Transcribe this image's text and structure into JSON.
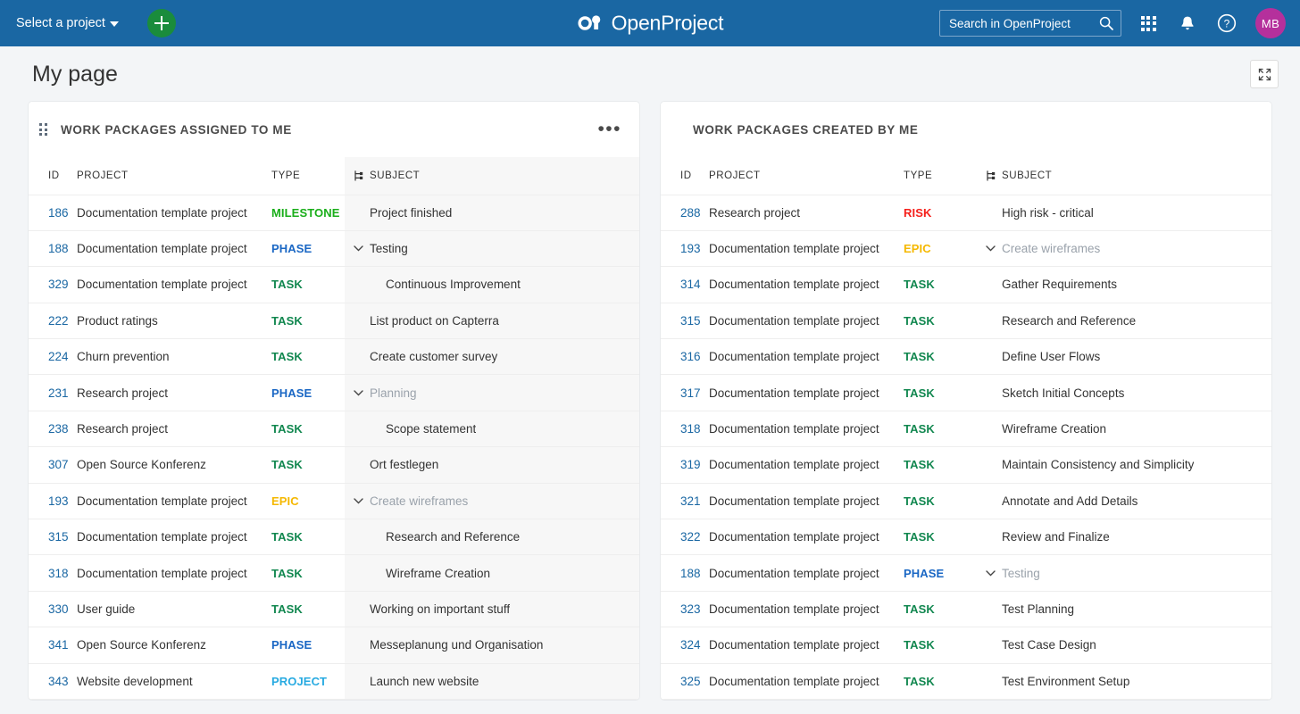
{
  "header": {
    "project_select_label": "Select a project",
    "add_button_label": "+",
    "brand_name": "OpenProject",
    "search_placeholder": "Search in OpenProject",
    "search_value": "",
    "avatar_initials": "MB"
  },
  "toolbar": {
    "page_title": "My page"
  },
  "widgets": [
    {
      "id": "assigned-to-me",
      "title": "WORK PACKAGES ASSIGNED TO ME",
      "menu_label": "•••",
      "columns": [
        "ID",
        "PROJECT",
        "TYPE",
        "SUBJECT"
      ],
      "rows": [
        {
          "id": "186",
          "project": "Documentation template project",
          "type": "MILESTONE",
          "subject": "Project finished",
          "indent": 0,
          "expandable": false,
          "ghost": false
        },
        {
          "id": "188",
          "project": "Documentation template project",
          "type": "PHASE",
          "subject": "Testing",
          "indent": 0,
          "expandable": true,
          "ghost": false
        },
        {
          "id": "329",
          "project": "Documentation template project",
          "type": "TASK",
          "subject": "Continuous Improvement",
          "indent": 1,
          "expandable": false,
          "ghost": false
        },
        {
          "id": "222",
          "project": "Product ratings",
          "type": "TASK",
          "subject": "List product on Capterra",
          "indent": 0,
          "expandable": false,
          "ghost": false
        },
        {
          "id": "224",
          "project": "Churn prevention",
          "type": "TASK",
          "subject": "Create customer survey",
          "indent": 0,
          "expandable": false,
          "ghost": false
        },
        {
          "id": "231",
          "project": "Research project",
          "type": "PHASE",
          "subject": "Planning",
          "indent": 0,
          "expandable": true,
          "ghost": true
        },
        {
          "id": "238",
          "project": "Research project",
          "type": "TASK",
          "subject": "Scope statement",
          "indent": 1,
          "expandable": false,
          "ghost": false
        },
        {
          "id": "307",
          "project": "Open Source Konferenz",
          "type": "TASK",
          "subject": "Ort festlegen",
          "indent": 0,
          "expandable": false,
          "ghost": false
        },
        {
          "id": "193",
          "project": "Documentation template project",
          "type": "EPIC",
          "subject": "Create wireframes",
          "indent": 0,
          "expandable": true,
          "ghost": true
        },
        {
          "id": "315",
          "project": "Documentation template project",
          "type": "TASK",
          "subject": "Research and Reference",
          "indent": 1,
          "expandable": false,
          "ghost": false
        },
        {
          "id": "318",
          "project": "Documentation template project",
          "type": "TASK",
          "subject": "Wireframe Creation",
          "indent": 1,
          "expandable": false,
          "ghost": false
        },
        {
          "id": "330",
          "project": "User guide",
          "type": "TASK",
          "subject": "Working on important stuff",
          "indent": 0,
          "expandable": false,
          "ghost": false
        },
        {
          "id": "341",
          "project": "Open Source Konferenz",
          "type": "PHASE",
          "subject": "Messeplanung und Organisation",
          "indent": 0,
          "expandable": false,
          "ghost": false
        },
        {
          "id": "343",
          "project": "Website development",
          "type": "PROJECT",
          "subject": "Launch new website",
          "indent": 0,
          "expandable": false,
          "ghost": false
        }
      ]
    },
    {
      "id": "created-by-me",
      "title": "WORK PACKAGES CREATED BY ME",
      "menu_label": "",
      "columns": [
        "ID",
        "PROJECT",
        "TYPE",
        "SUBJECT"
      ],
      "rows": [
        {
          "id": "288",
          "project": "Research project",
          "type": "RISK",
          "subject": "High risk - critical",
          "indent": 0,
          "expandable": false,
          "ghost": false
        },
        {
          "id": "193",
          "project": "Documentation template project",
          "type": "EPIC",
          "subject": "Create wireframes",
          "indent": 0,
          "expandable": true,
          "ghost": true
        },
        {
          "id": "314",
          "project": "Documentation template project",
          "type": "TASK",
          "subject": "Gather Requirements",
          "indent": 0,
          "expandable": false,
          "ghost": false
        },
        {
          "id": "315",
          "project": "Documentation template project",
          "type": "TASK",
          "subject": "Research and Reference",
          "indent": 0,
          "expandable": false,
          "ghost": false
        },
        {
          "id": "316",
          "project": "Documentation template project",
          "type": "TASK",
          "subject": "Define User Flows",
          "indent": 0,
          "expandable": false,
          "ghost": false
        },
        {
          "id": "317",
          "project": "Documentation template project",
          "type": "TASK",
          "subject": "Sketch Initial Concepts",
          "indent": 0,
          "expandable": false,
          "ghost": false
        },
        {
          "id": "318",
          "project": "Documentation template project",
          "type": "TASK",
          "subject": "Wireframe Creation",
          "indent": 0,
          "expandable": false,
          "ghost": false
        },
        {
          "id": "319",
          "project": "Documentation template project",
          "type": "TASK",
          "subject": "Maintain Consistency and Simplicity",
          "indent": 0,
          "expandable": false,
          "ghost": false
        },
        {
          "id": "321",
          "project": "Documentation template project",
          "type": "TASK",
          "subject": "Annotate and Add Details",
          "indent": 0,
          "expandable": false,
          "ghost": false
        },
        {
          "id": "322",
          "project": "Documentation template project",
          "type": "TASK",
          "subject": "Review and Finalize",
          "indent": 0,
          "expandable": false,
          "ghost": false
        },
        {
          "id": "188",
          "project": "Documentation template project",
          "type": "PHASE",
          "subject": "Testing",
          "indent": 0,
          "expandable": true,
          "ghost": true
        },
        {
          "id": "323",
          "project": "Documentation template project",
          "type": "TASK",
          "subject": "Test Planning",
          "indent": 0,
          "expandable": false,
          "ghost": false
        },
        {
          "id": "324",
          "project": "Documentation template project",
          "type": "TASK",
          "subject": "Test Case Design",
          "indent": 0,
          "expandable": false,
          "ghost": false
        },
        {
          "id": "325",
          "project": "Documentation template project",
          "type": "TASK",
          "subject": "Test Environment Setup",
          "indent": 0,
          "expandable": false,
          "ghost": false
        }
      ]
    }
  ],
  "colors": {
    "header_blue": "#1A67A3",
    "add_green": "#1A8C3C",
    "avatar_magenta": "#B5309C",
    "page_bg": "#F3F5F7",
    "type_milestone": "#1AAE1A",
    "type_phase": "#1A67C4",
    "type_task": "#11874F",
    "type_epic": "#F5B800",
    "type_project": "#27AAE1",
    "type_risk": "#F5201B"
  },
  "icons": {
    "chevron_down": "chevron-down-icon",
    "search": "search-icon",
    "modules_grid": "modules-grid-icon",
    "notifications": "bell-icon",
    "help": "help-circle-icon",
    "fullscreen": "fullscreen-icon",
    "hierarchy": "hierarchy-icon",
    "drag": "drag-handle-icon"
  }
}
